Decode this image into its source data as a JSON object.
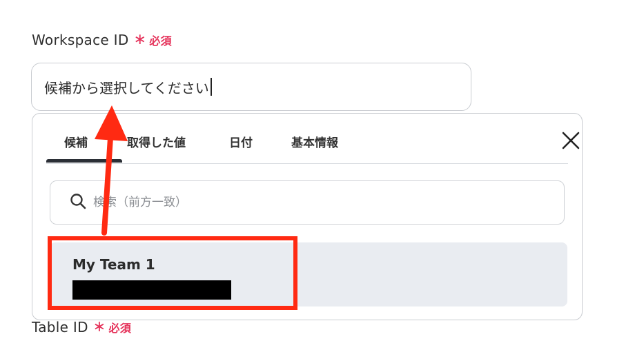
{
  "workspace": {
    "label": "Workspace ID",
    "required_star": "∗",
    "required_text": "必須",
    "input_value": "候補から選択してください"
  },
  "dropdown": {
    "tabs": [
      {
        "label": "候補",
        "active": true
      },
      {
        "label": "取得した値",
        "active": false
      },
      {
        "label": "日付",
        "active": false
      },
      {
        "label": "基本情報",
        "active": false
      }
    ],
    "close_icon": "close-icon",
    "search_placeholder": "検索（前方一致）",
    "search_icon": "search-icon",
    "options": [
      {
        "title": "My Team 1",
        "subtitle_redacted": true
      }
    ]
  },
  "table": {
    "label": "Table ID",
    "required_star": "∗",
    "required_text": "必須"
  },
  "annotation": {
    "color": "#ff2a12"
  },
  "colors": {
    "required": "#e5325a",
    "selected_bg": "#e9ecf1",
    "tab_active": "#2b2f36"
  }
}
